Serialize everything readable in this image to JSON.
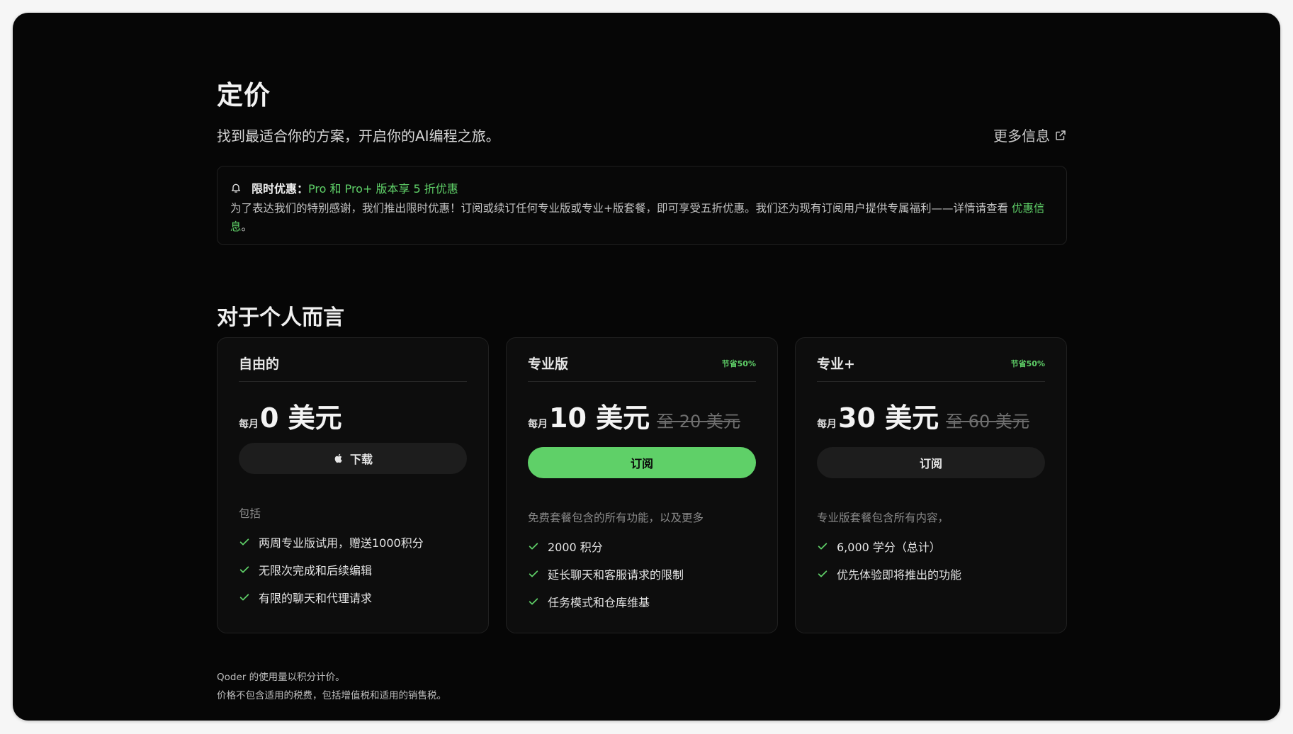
{
  "colors": {
    "accent": "#5fd068",
    "background": "#060606",
    "card": "#0d0d0d"
  },
  "header": {
    "title": "定价",
    "subtitle": "找到最适合你的方案，开启你的AI编程之旅。",
    "more_info": "更多信息",
    "more_info_icon": "external-link-icon"
  },
  "promo": {
    "icon": "bell-icon",
    "label": "限时优惠：",
    "highlight": "Pro 和 Pro+ 版本享 5 折优惠",
    "body": "为了表达我们的特别感谢，我们推出限时优惠！订阅或续订任何专业版或专业+版套餐，即可享受五折优惠。我们还为现有订阅用户提供专属福利——详情请查看 ",
    "link": "优惠信息",
    "tail": "。"
  },
  "section": {
    "title": "对于个人而言"
  },
  "plans": [
    {
      "name": "自由的",
      "badge": "",
      "per": "每月",
      "price": "0 美元",
      "old_price": "",
      "button": "下载",
      "button_icon": "apple-icon",
      "includes": "包括",
      "features": [
        "两周专业版试用，赠送1000积分",
        "无限次完成和后续编辑",
        "有限的聊天和代理请求"
      ]
    },
    {
      "name": "专业版",
      "badge": "节省50%",
      "per": "每月",
      "price": "10 美元",
      "old_price": "至 20 美元",
      "button": "订阅",
      "button_icon": "",
      "includes": "免费套餐包含的所有功能，以及更多",
      "features": [
        "2000 积分",
        "延长聊天和客服请求的限制",
        "任务模式和仓库维基"
      ]
    },
    {
      "name": "专业+",
      "badge": "节省50%",
      "per": "每月",
      "price": "30 美元",
      "old_price": "至 60 美元",
      "button": "订阅",
      "button_icon": "",
      "includes": "专业版套餐包含所有内容，",
      "features": [
        "6,000 学分（总计）",
        "优先体验即将推出的功能"
      ]
    }
  ],
  "footer": {
    "line1": "Qoder 的使用量以积分计价。",
    "line2": "价格不包含适用的税费，包括增值税和适用的销售税。"
  }
}
